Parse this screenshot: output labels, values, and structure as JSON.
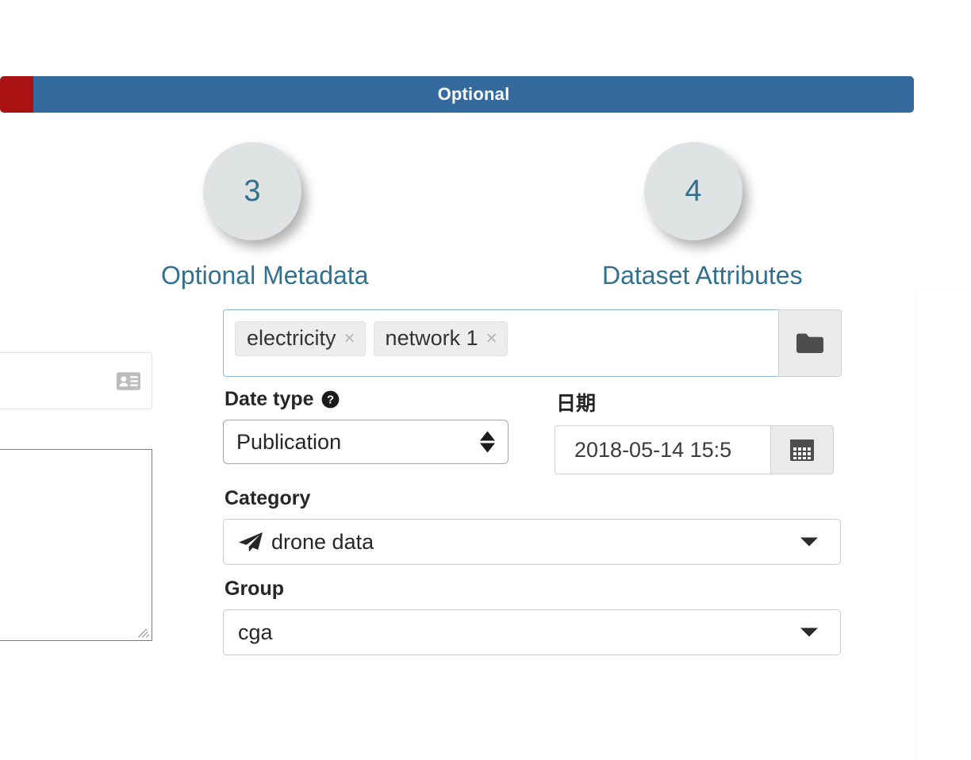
{
  "stepbar": {
    "current_label": "Optional",
    "red_color": "#a81212",
    "blue_color": "#336a9e"
  },
  "steps": [
    {
      "number": "3",
      "label": "Optional Metadata",
      "icon": "step-circle-icon"
    },
    {
      "number": "4",
      "label": "Dataset Attributes",
      "icon": "step-circle-icon"
    }
  ],
  "tags_field": {
    "tags": [
      {
        "label": "electricity",
        "remove_icon": "close-icon",
        "remove_glyph": "×"
      },
      {
        "label": "network 1",
        "remove_icon": "close-icon",
        "remove_glyph": "×"
      }
    ],
    "browse_button": {
      "icon": "folder-icon",
      "title": "Browse"
    }
  },
  "date_type": {
    "label": "Date type",
    "help_icon": "question-circle-icon",
    "value": "Publication",
    "options": [
      "Publication"
    ]
  },
  "date": {
    "label": "日期",
    "value": "2018-05-14 15:5",
    "calendar_button": {
      "icon": "calendar-icon"
    }
  },
  "category": {
    "label": "Category",
    "value": "drone data",
    "value_icon": "paper-plane-icon",
    "caret_icon": "caret-down-icon"
  },
  "group": {
    "label": "Group",
    "value": "cga",
    "caret_icon": "caret-down-icon"
  },
  "left_clipped": {
    "contact_input": {
      "icon": "vcard-icon",
      "value": ""
    },
    "description_textarea": {
      "value": "",
      "resize_handle": "resize-grip-icon"
    }
  },
  "colors": {
    "accent_blue": "#31708f",
    "bar_blue": "#336a9e",
    "bar_red": "#a81212",
    "focus_border": "#89b9df"
  }
}
